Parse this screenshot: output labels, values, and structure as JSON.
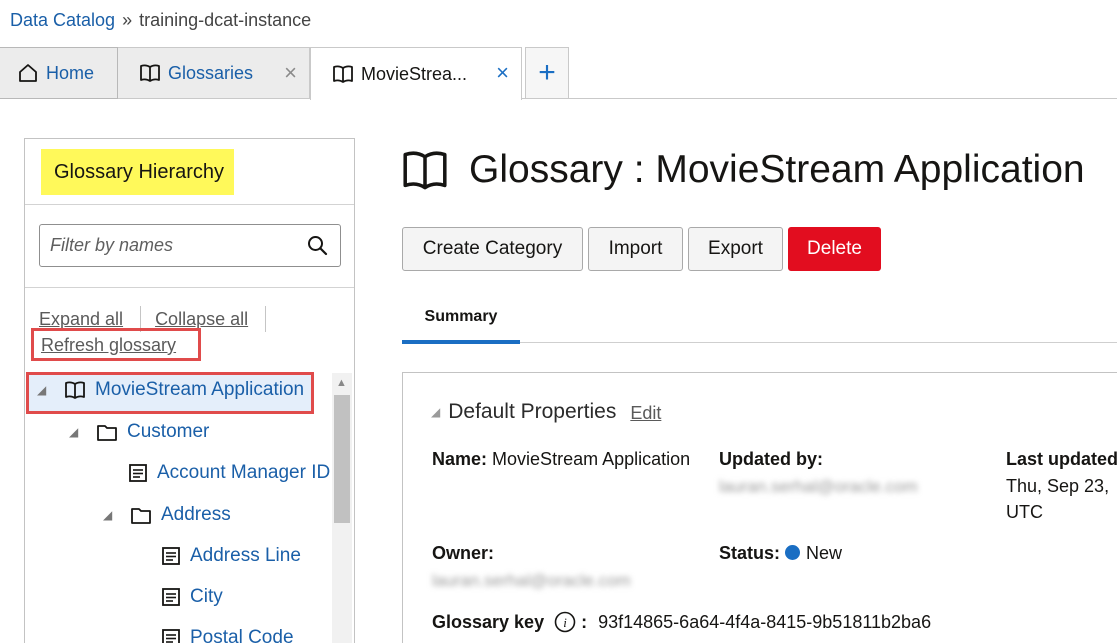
{
  "breadcrumb": {
    "root": "Data Catalog",
    "separator": "»",
    "current": "training-dcat-instance"
  },
  "tabs": {
    "home": {
      "label": "Home",
      "icon": "home-icon"
    },
    "glossaries": {
      "label": "Glossaries",
      "icon": "book-icon",
      "close": "×"
    },
    "movie": {
      "label": "MovieStrea...",
      "icon": "book-icon",
      "close": "×"
    },
    "add": "+"
  },
  "sidebar": {
    "title": "Glossary Hierarchy",
    "filter_placeholder": "Filter by names",
    "expand_all": "Expand all",
    "collapse_all": "Collapse all",
    "refresh": "Refresh glossary",
    "tree": {
      "root": "MovieStream Application",
      "customer": "Customer",
      "account_manager_id": "Account Manager ID",
      "address": "Address",
      "address_line": "Address Line",
      "city": "City",
      "postal_code": "Postal Code"
    }
  },
  "main": {
    "title": "Glossary : MovieStream Application",
    "buttons": {
      "create": "Create Category",
      "import": "Import",
      "export": "Export",
      "delete": "Delete"
    },
    "tab_summary": "Summary",
    "section": {
      "title": "Default Properties",
      "edit": "Edit"
    },
    "fields": {
      "name_label": "Name:",
      "name_value": "MovieStream Application",
      "updated_by_label": "Updated by:",
      "updated_by_value": "lauran.serhal@oracle.com",
      "last_updated_label": "Last updated",
      "last_updated_value_1": "Thu, Sep 23,",
      "last_updated_value_2": "UTC",
      "owner_label": "Owner:",
      "owner_value": "lauran.serhal@oracle.com",
      "status_label": "Status:",
      "status_value": "New",
      "key_label": "Glossary key",
      "key_colon": ":",
      "key_value": "93f14865-6a64-4f4a-8415-9b51811b2ba6"
    }
  },
  "colors": {
    "accent": "#1a6ec3",
    "link": "#1a5fa8",
    "delete": "#e20d1f",
    "highlight": "#fff95a",
    "callout": "#e04b4b"
  }
}
